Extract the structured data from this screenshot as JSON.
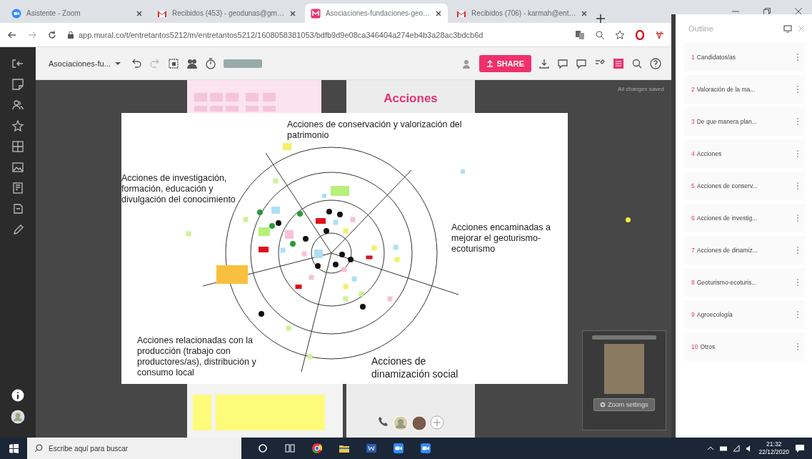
{
  "browser": {
    "tabs": [
      {
        "title": "Asistente - Zoom",
        "selected": false
      },
      {
        "title": "Recibidos (453) - geodunas@gm…",
        "selected": false
      },
      {
        "title": "Asociaciones-fundaciones-geo…",
        "selected": true
      },
      {
        "title": "Recibidos (706) - karmah@ent…",
        "selected": false
      }
    ],
    "url": "app.mural.co/t/entretantos5212/m/entretantos5212/1608058381053/bdfb9d9e08ca346404a274eb4b3a28ac3bdcb6d"
  },
  "mural": {
    "title": "Asociaciones-fu...",
    "share": "SHARE",
    "status": "All changes saved",
    "section_title": "Acciones",
    "board_labels": [
      "Acciones de conservación y valorización del patrimonio",
      "Acciones de investigación, formación, educación y divulgación del conocimiento",
      "Acciones encaminadas a mejorar el geoturismo-ecoturismo",
      "Acciones relacionadas con la producción (trabajo con productores/as), distribución y consumo local",
      "Acciones de dinamización social"
    ],
    "zoom_settings": "Zoom settings"
  },
  "outline": {
    "title": "Outline",
    "items": [
      {
        "number": "1",
        "label": "Candidatos/as"
      },
      {
        "number": "2",
        "label": "Valoración de la ma..."
      },
      {
        "number": "3",
        "label": "De que manera plan..."
      },
      {
        "number": "4",
        "label": "Acciones"
      },
      {
        "number": "5",
        "label": "Acciones de conserv..."
      },
      {
        "number": "6",
        "label": "Acciones de investig..."
      },
      {
        "number": "7",
        "label": "Acciones de dinamiz..."
      },
      {
        "number": "8",
        "label": "Geoturismo-ecoturis..."
      },
      {
        "number": "9",
        "label": "Agroecología"
      },
      {
        "number": "10",
        "label": "Otros"
      }
    ]
  },
  "taskbar": {
    "search_placeholder": "Escribe aquí para buscar",
    "time": "21:32",
    "date": "22/12/2020"
  }
}
